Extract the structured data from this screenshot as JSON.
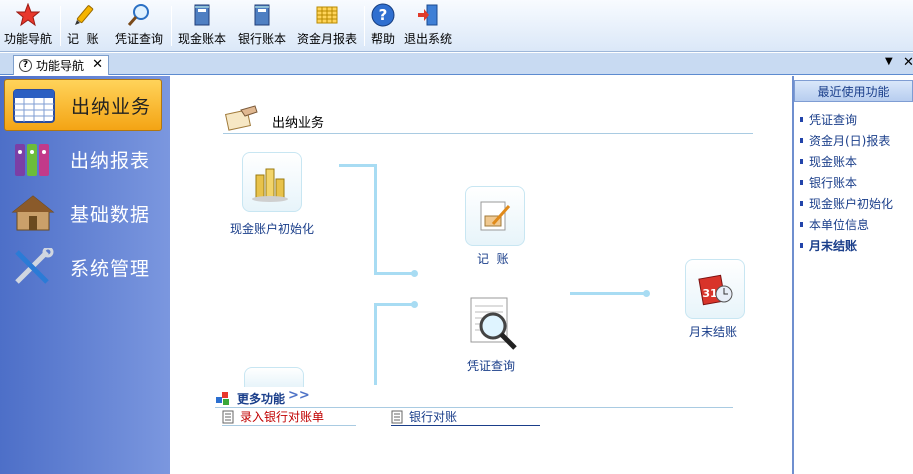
{
  "toolbar": {
    "items": [
      {
        "label": "功能导航",
        "icon": "star-icon"
      },
      {
        "label": "记  账",
        "icon": "pencil-icon"
      },
      {
        "label": "凭证查询",
        "icon": "magnifier-icon"
      },
      {
        "label": "现金账本",
        "icon": "ledger-icon"
      },
      {
        "label": "银行账本",
        "icon": "ledger-icon"
      },
      {
        "label": "资金月报表",
        "icon": "spreadsheet-icon"
      },
      {
        "label": "帮助",
        "icon": "help-icon"
      },
      {
        "label": "退出系统",
        "icon": "exit-icon"
      }
    ]
  },
  "tabs": [
    {
      "label": "功能导航",
      "icon": "help-icon"
    }
  ],
  "leftnav": {
    "items": [
      {
        "label": "出纳业务",
        "icon": "calendar-icon",
        "active": true
      },
      {
        "label": "出纳报表",
        "icon": "binders-icon",
        "active": false
      },
      {
        "label": "基础数据",
        "icon": "house-icon",
        "active": false
      },
      {
        "label": "系统管理",
        "icon": "tools-icon",
        "active": false
      }
    ]
  },
  "main": {
    "section_title": "出纳业务",
    "nodes": {
      "cash_init": "现金账户初始化",
      "journal": "记  账",
      "voucher_query": "凭证查询",
      "month_end": "月末结账"
    },
    "more_label": "更多功能",
    "more_arrows": ">>",
    "sub_links": [
      "录入银行对账单",
      "银行对账"
    ]
  },
  "rightpanel": {
    "title": "最近使用功能",
    "items": [
      {
        "label": "凭证查询",
        "bold": false
      },
      {
        "label": "资金月(日)报表",
        "bold": false
      },
      {
        "label": "现金账本",
        "bold": false
      },
      {
        "label": "银行账本",
        "bold": false
      },
      {
        "label": "现金账户初始化",
        "bold": false
      },
      {
        "label": "本单位信息",
        "bold": false
      },
      {
        "label": "月末结账",
        "bold": true
      }
    ]
  },
  "colors": {
    "accent_blue": "#4d6fc8",
    "active_orange": "#f4a414",
    "flow_line": "#a8dcf3",
    "link_red": "#c00000",
    "link_blue": "#1a3e8a"
  }
}
